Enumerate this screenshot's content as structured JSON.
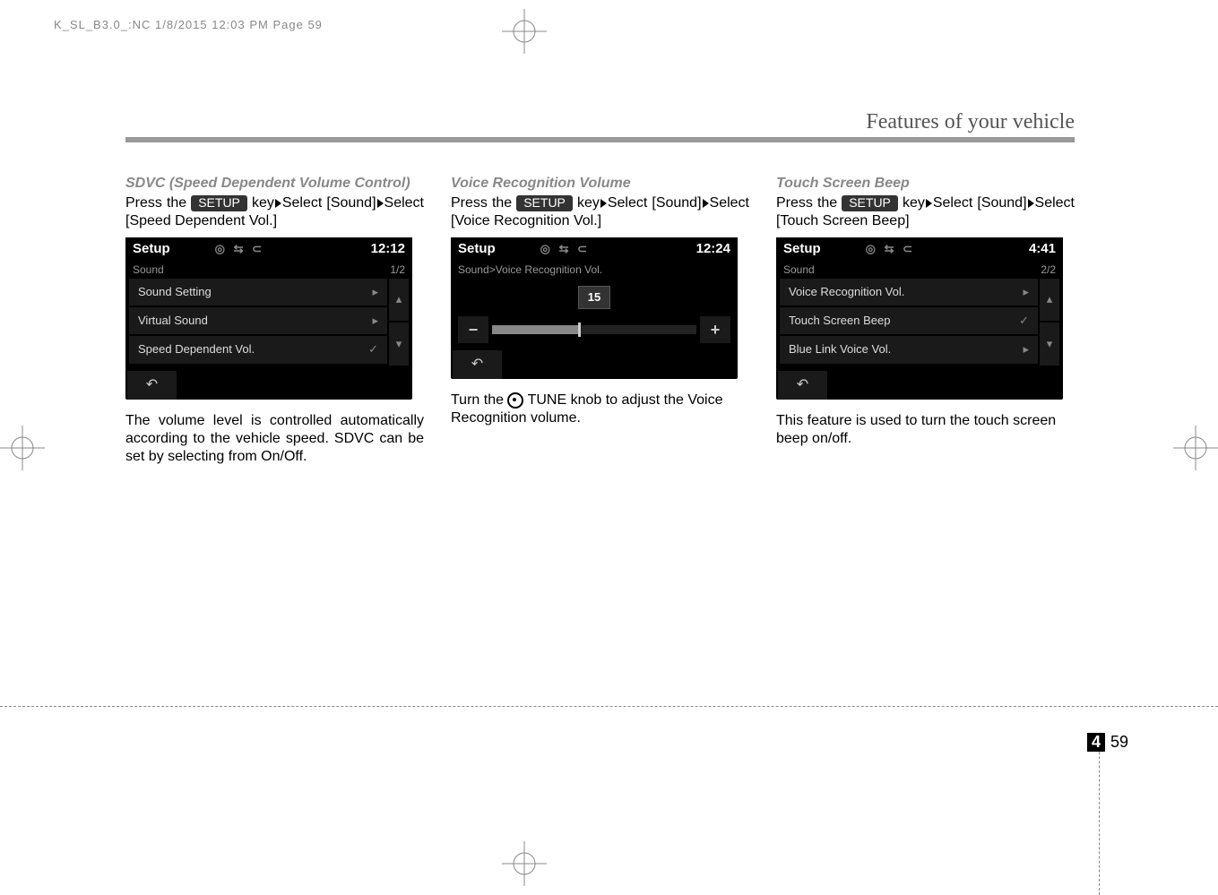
{
  "meta": {
    "header_line": "K_SL_B3.0_:NC  1/8/2015  12:03 PM  Page 59",
    "chapter_title": "Features of your vehicle",
    "page_chapter": "4",
    "page_number": "59"
  },
  "col1": {
    "heading": "SDVC (Speed Dependent Volume Control)",
    "intro_pre": "Press the ",
    "setup_label": "SETUP",
    "intro_post1": " key",
    "intro_post2": "Select [Sound]",
    "intro_post3": "Select [Speed Dependent Vol.]",
    "body": "The volume level is controlled automatically according to the vehicle speed. SDVC can be set by selecting from On/Off.",
    "screen": {
      "title": "Setup",
      "icons": "◎  ⇆ ⊂",
      "clock": "12:12",
      "sub_left": "Sound",
      "sub_right": "1/2",
      "rows": [
        {
          "label": "Sound Setting",
          "mark": "▸"
        },
        {
          "label": "Virtual Sound",
          "mark": "▸"
        },
        {
          "label": "Speed Dependent Vol.",
          "mark": "✓"
        }
      ],
      "scroll_up": "▴",
      "scroll_down": "▾",
      "back": "↶"
    }
  },
  "col2": {
    "heading": "Voice Recognition Volume",
    "intro_pre": "Press the ",
    "setup_label": "SETUP",
    "intro_post1": " key",
    "intro_post2": "Select [Sound]",
    "intro_post3": "Select [Voice Recognition Vol.]",
    "body_pre": "Turn the ",
    "body_post": "TUNE knob to adjust the Voice Recognition volume.",
    "screen": {
      "title": "Setup",
      "icons": "◎  ⇆ ⊂",
      "clock": "12:24",
      "sub_left": "Sound>Voice Recognition Vol.",
      "vol_value": "15",
      "minus": "−",
      "plus": "+",
      "back": "↶"
    }
  },
  "col3": {
    "heading": "Touch Screen Beep",
    "intro_pre": "Press the ",
    "setup_label": "SETUP",
    "intro_post1": " key",
    "intro_post2": "Select [Sound]",
    "intro_post3": "Select [Touch Screen Beep]",
    "body": "This feature is used to turn the touch screen beep on/off.",
    "screen": {
      "title": "Setup",
      "icons": "◎  ⇆ ⊂",
      "clock": "4:41",
      "sub_left": "Sound",
      "sub_right": "2/2",
      "rows": [
        {
          "label": "Voice Recognition Vol.",
          "mark": "▸"
        },
        {
          "label": "Touch Screen Beep",
          "mark": "✓"
        },
        {
          "label": "Blue Link Voice Vol.",
          "mark": "▸"
        }
      ],
      "scroll_up": "▴",
      "scroll_down": "▾",
      "back": "↶"
    }
  }
}
